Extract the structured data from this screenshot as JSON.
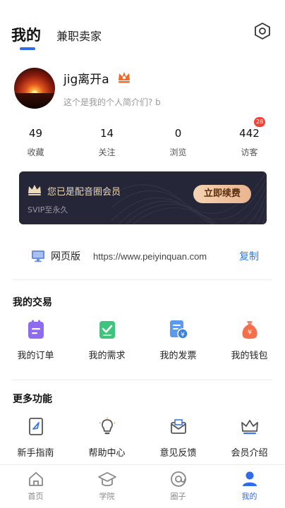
{
  "header": {
    "active_tab": "我的",
    "other_tab": "兼职卖家"
  },
  "profile": {
    "name": "jig离开a",
    "bio": "这个是我的个人简介们? b"
  },
  "stats": [
    {
      "value": "49",
      "label": "收藏"
    },
    {
      "value": "14",
      "label": "关注"
    },
    {
      "value": "0",
      "label": "浏览"
    },
    {
      "value": "442",
      "label": "访客",
      "badge": "28"
    }
  ],
  "vip": {
    "title": "您已是配音圈会员",
    "subtitle": "SVIP至永久",
    "renew_label": "立即续费"
  },
  "web": {
    "label": "网页版",
    "url": "https://www.peiyinquan.com",
    "copy_label": "复制"
  },
  "trade": {
    "title": "我的交易",
    "items": [
      {
        "label": "我的订单",
        "icon": "order-icon"
      },
      {
        "label": "我的需求",
        "icon": "demand-icon"
      },
      {
        "label": "我的发票",
        "icon": "invoice-icon"
      },
      {
        "label": "我的钱包",
        "icon": "wallet-icon"
      }
    ]
  },
  "more": {
    "title": "更多功能",
    "items": [
      {
        "label": "新手指南",
        "icon": "guide-icon"
      },
      {
        "label": "帮助中心",
        "icon": "help-icon"
      },
      {
        "label": "意见反馈",
        "icon": "feedback-icon"
      },
      {
        "label": "会员介绍",
        "icon": "member-icon"
      }
    ]
  },
  "nav": [
    {
      "label": "首页",
      "icon": "home-icon"
    },
    {
      "label": "学院",
      "icon": "academy-icon"
    },
    {
      "label": "圈子",
      "icon": "circle-icon"
    },
    {
      "label": "我的",
      "icon": "profile-icon",
      "active": true
    }
  ],
  "colors": {
    "accent": "#2f6bea",
    "vip_bg": "#252638",
    "badge": "#f44336"
  }
}
